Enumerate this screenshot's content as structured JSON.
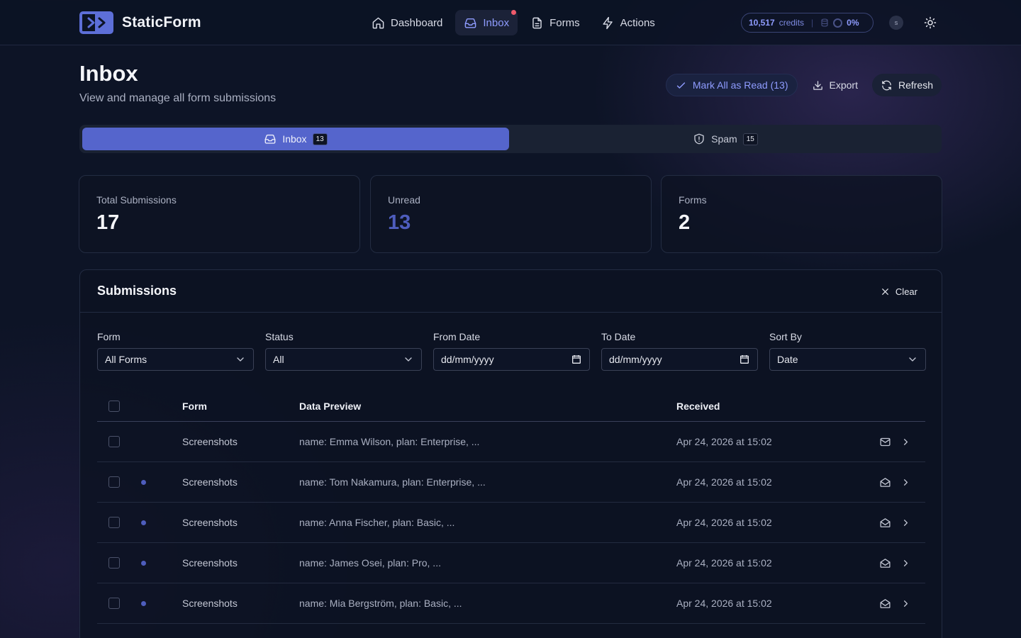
{
  "brand": {
    "name": "StaticForm"
  },
  "nav": {
    "items": [
      {
        "label": "Dashboard",
        "icon": "home-icon"
      },
      {
        "label": "Inbox",
        "icon": "inbox-icon",
        "active": true,
        "notification": true
      },
      {
        "label": "Forms",
        "icon": "document-icon"
      },
      {
        "label": "Actions",
        "icon": "lightning-icon"
      }
    ]
  },
  "credits": {
    "amount": "10,517",
    "label": "credits",
    "usage": "0%"
  },
  "user": {
    "initial": "s"
  },
  "header": {
    "title": "Inbox",
    "subtitle": "View and manage all form submissions",
    "mark_all_label": "Mark All as Read (13)",
    "export_label": "Export",
    "refresh_label": "Refresh"
  },
  "tabs": [
    {
      "label": "Inbox",
      "count": "13",
      "active": true
    },
    {
      "label": "Spam",
      "count": "15",
      "active": false
    }
  ],
  "stats": [
    {
      "label": "Total Submissions",
      "value": "17"
    },
    {
      "label": "Unread",
      "value": "13"
    },
    {
      "label": "Forms",
      "value": "2"
    }
  ],
  "submissions": {
    "title": "Submissions",
    "clear_label": "Clear",
    "filters": {
      "form": {
        "label": "Form",
        "value": "All Forms"
      },
      "status": {
        "label": "Status",
        "value": "All"
      },
      "from_date": {
        "label": "From Date",
        "value": "dd/mm/yyyy"
      },
      "to_date": {
        "label": "To Date",
        "value": "dd/mm/yyyy"
      },
      "sort_by": {
        "label": "Sort By",
        "value": "Date"
      }
    },
    "columns": [
      "Form",
      "Data Preview",
      "Received"
    ],
    "rows": [
      {
        "form": "Screenshots",
        "preview": "name: Emma Wilson, plan: Enterprise, ...",
        "received": "Apr 24, 2026 at 15:02",
        "unread": false
      },
      {
        "form": "Screenshots",
        "preview": "name: Tom Nakamura, plan: Enterprise, ...",
        "received": "Apr 24, 2026 at 15:02",
        "unread": true
      },
      {
        "form": "Screenshots",
        "preview": "name: Anna Fischer, plan: Basic, ...",
        "received": "Apr 24, 2026 at 15:02",
        "unread": true
      },
      {
        "form": "Screenshots",
        "preview": "name: James Osei, plan: Pro, ...",
        "received": "Apr 24, 2026 at 15:02",
        "unread": true
      },
      {
        "form": "Screenshots",
        "preview": "name: Mia Bergström, plan: Basic, ...",
        "received": "Apr 24, 2026 at 15:02",
        "unread": true
      }
    ]
  },
  "colors": {
    "accent": "#5565cc",
    "accent_text": "#8f9cff",
    "unread_dot": "#4e5dbd",
    "notification": "#ef5a6b"
  }
}
